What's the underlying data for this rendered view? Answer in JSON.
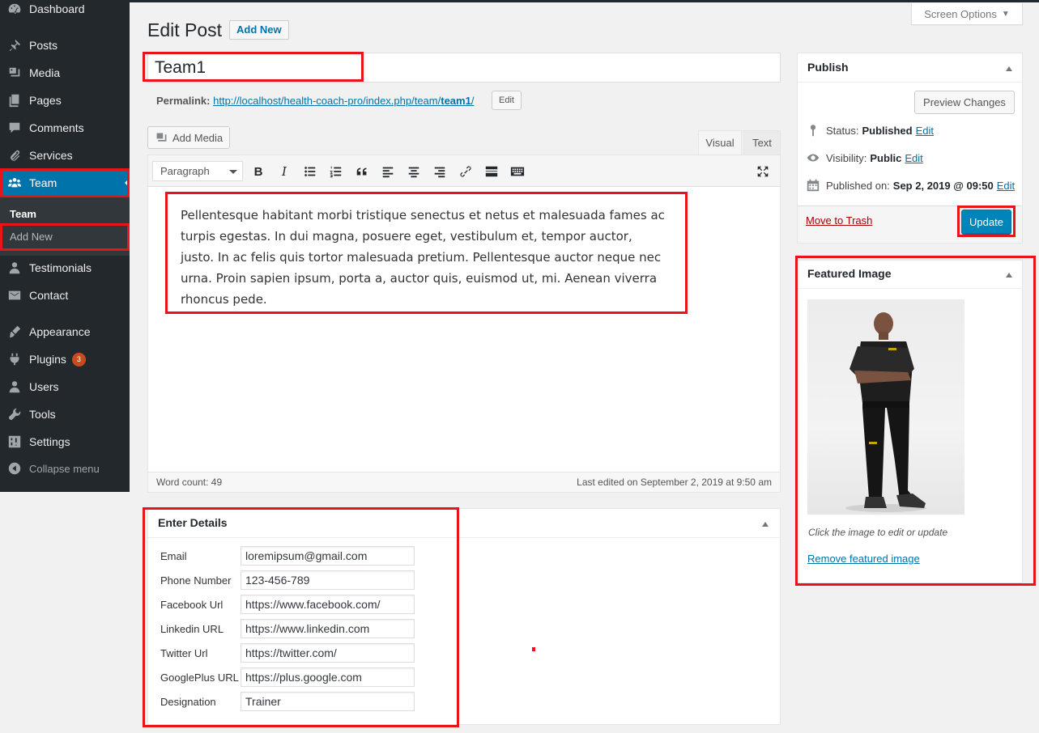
{
  "sidebar": {
    "items": [
      {
        "label": "Dashboard",
        "icon": "dashboard-icon"
      },
      {
        "label": "Posts",
        "icon": "pin-icon"
      },
      {
        "label": "Media",
        "icon": "media-icon"
      },
      {
        "label": "Pages",
        "icon": "pages-icon"
      },
      {
        "label": "Comments",
        "icon": "comments-icon"
      },
      {
        "label": "Services",
        "icon": "paperclip-icon"
      },
      {
        "label": "Team",
        "icon": "team-icon"
      },
      {
        "label": "Testimonials",
        "icon": "user-icon"
      },
      {
        "label": "Contact",
        "icon": "email-icon"
      },
      {
        "label": "Appearance",
        "icon": "brush-icon"
      },
      {
        "label": "Plugins",
        "icon": "plugin-icon"
      },
      {
        "label": "Users",
        "icon": "user-icon"
      },
      {
        "label": "Tools",
        "icon": "wrench-icon"
      },
      {
        "label": "Settings",
        "icon": "settings-icon"
      }
    ],
    "plugins_badge": "3",
    "submenu": {
      "current": "Team",
      "add_new": "Add New"
    },
    "collapse_label": "Collapse menu"
  },
  "header": {
    "screen_options": "Screen Options",
    "title": "Edit Post",
    "add_new": "Add New"
  },
  "post": {
    "title": "Team1",
    "permalink_label": "Permalink:",
    "permalink_base": "http://localhost/health-coach-pro/index.php/team/",
    "permalink_slug": "team1",
    "permalink_end": "/",
    "permalink_edit": "Edit"
  },
  "editor": {
    "add_media": "Add Media",
    "tab_visual": "Visual",
    "tab_text": "Text",
    "format": "Paragraph",
    "content": "Pellentesque habitant morbi tristique senectus et netus et malesuada fames ac turpis egestas. In dui magna, posuere eget, vestibulum et, tempor auctor, justo. In ac felis quis tortor malesuada pretium. Pellentesque auctor neque nec urna. Proin sapien ipsum, porta a, auctor quis, euismod ut, mi. Aenean viverra rhoncus pede.",
    "word_count": "Word count: 49",
    "last_edited": "Last edited on September 2, 2019 at 9:50 am"
  },
  "details": {
    "title": "Enter Details",
    "fields": [
      {
        "label": "Email",
        "value": "loremipsum@gmail.com"
      },
      {
        "label": "Phone Number",
        "value": "123-456-789"
      },
      {
        "label": "Facebook Url",
        "value": "https://www.facebook.com/"
      },
      {
        "label": "Linkedin URL",
        "value": "https://www.linkedin.com"
      },
      {
        "label": "Twitter Url",
        "value": "https://twitter.com/"
      },
      {
        "label": "GooglePlus URL",
        "value": "https://plus.google.com"
      },
      {
        "label": "Designation",
        "value": "Trainer"
      }
    ]
  },
  "publish": {
    "title": "Publish",
    "preview": "Preview Changes",
    "status_label": "Status:",
    "status_value": "Published",
    "visibility_label": "Visibility:",
    "visibility_value": "Public",
    "published_label": "Published on:",
    "published_value": "Sep 2, 2019 @ 09:50",
    "edit": "Edit",
    "trash": "Move to Trash",
    "update": "Update"
  },
  "featured": {
    "title": "Featured Image",
    "hint": "Click the image to edit or update",
    "remove": "Remove featured image"
  },
  "colors": {
    "accent": "#0073aa",
    "sidebar_bg": "#23282d",
    "highlight": "#e8141b"
  }
}
